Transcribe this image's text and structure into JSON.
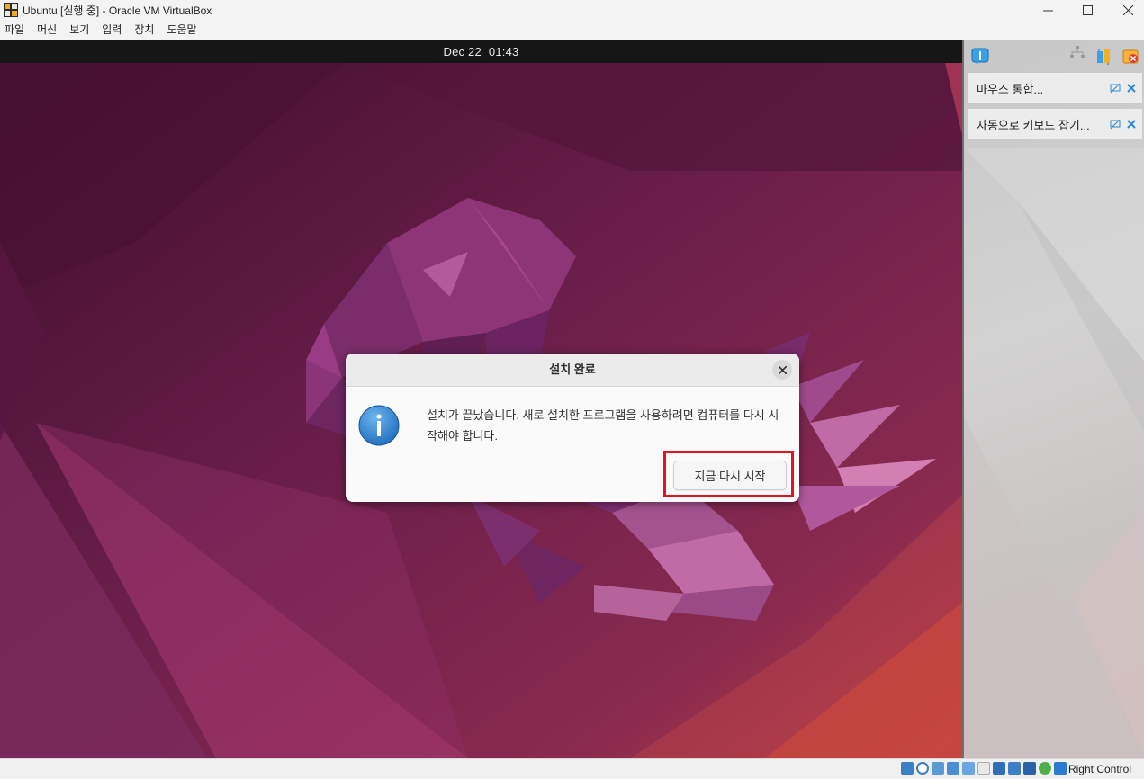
{
  "window": {
    "title": "Ubuntu [실행 중] - Oracle VM VirtualBox"
  },
  "menu": [
    "파일",
    "머신",
    "보기",
    "입력",
    "장치",
    "도움말"
  ],
  "vm": {
    "topbar_date": "Dec 22",
    "topbar_time": "01:43"
  },
  "dialog": {
    "title": "설치 완료",
    "message": "설치가 끝났습니다. 새로 설치한 프로그램을 사용하려면 컴퓨터를 다시 시작해야 합니다.",
    "restart_button": "지금 다시 시작"
  },
  "panel": {
    "notifications": [
      {
        "label": "마우스 통합..."
      },
      {
        "label": "자동으로 키보드 잡기..."
      }
    ]
  },
  "statusbar": {
    "host_key": "Right Control",
    "icons": [
      "hard-disk-icon",
      "optical-drive-icon",
      "audio-icon",
      "network-icon",
      "usb-icon",
      "shared-folders-icon",
      "display-icon",
      "video-capture-icon",
      "virtualization-icon",
      "mouse-integration-icon",
      "keyboard-icon"
    ]
  },
  "colors": {
    "highlight": "#e3141f",
    "wallpaper_base": "#5a1a3c",
    "topbar": "#161616"
  }
}
